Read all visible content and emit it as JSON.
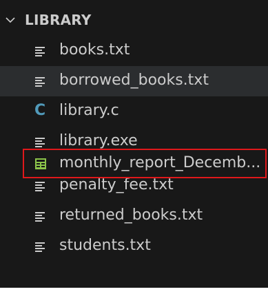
{
  "explorer": {
    "folder_name": "LIBRARY",
    "items": [
      {
        "name": "books.txt",
        "icon": "text-lines-icon"
      },
      {
        "name": "borrowed_books.txt",
        "icon": "text-lines-icon"
      },
      {
        "name": "library.c",
        "icon": "c-file-icon"
      },
      {
        "name": "library.exe",
        "icon": "text-lines-icon"
      },
      {
        "name": "monthly_report_Decemb...",
        "icon": "spreadsheet-icon"
      },
      {
        "name": "penalty_fee.txt",
        "icon": "text-lines-icon"
      },
      {
        "name": "returned_books.txt",
        "icon": "text-lines-icon"
      },
      {
        "name": "students.txt",
        "icon": "text-lines-icon"
      }
    ],
    "c_icon_glyph": "C",
    "colors": {
      "background": "#181818",
      "text": "#cccccc",
      "hover_row": "#2b2d2f",
      "c_icon": "#519aba",
      "spreadsheet_icon": "#8bc34a",
      "highlight_border": "#e0181b"
    }
  }
}
